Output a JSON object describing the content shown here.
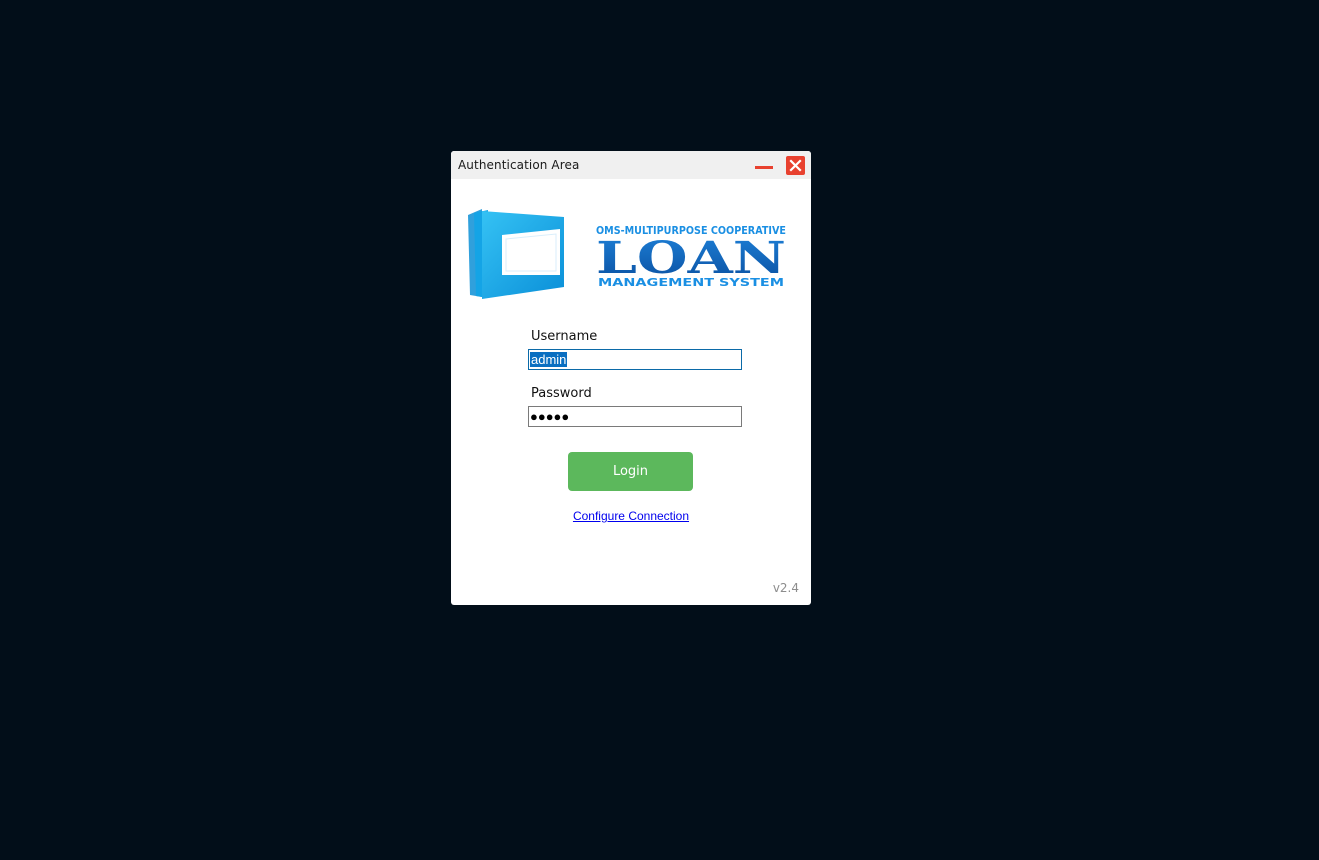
{
  "window": {
    "title": "Authentication Area"
  },
  "logo": {
    "line1": "OMS-MULTIPURPOSE COOPERATIVE",
    "line2": "LOAN",
    "line3": "MANAGEMENT SYSTEM",
    "primary_color": "#0a72c8",
    "accent_color": "#1aa7ec"
  },
  "form": {
    "username_label": "Username",
    "username_value": "admin",
    "password_label": "Password",
    "password_mask": "●●●●●",
    "login_label": "Login",
    "configure_link": "Configure Connection"
  },
  "footer": {
    "version": "v2.4"
  },
  "colors": {
    "background": "#020e19",
    "login_button": "#5cb85c",
    "close_button": "#e8412f",
    "selection": "#0a6fc1"
  }
}
